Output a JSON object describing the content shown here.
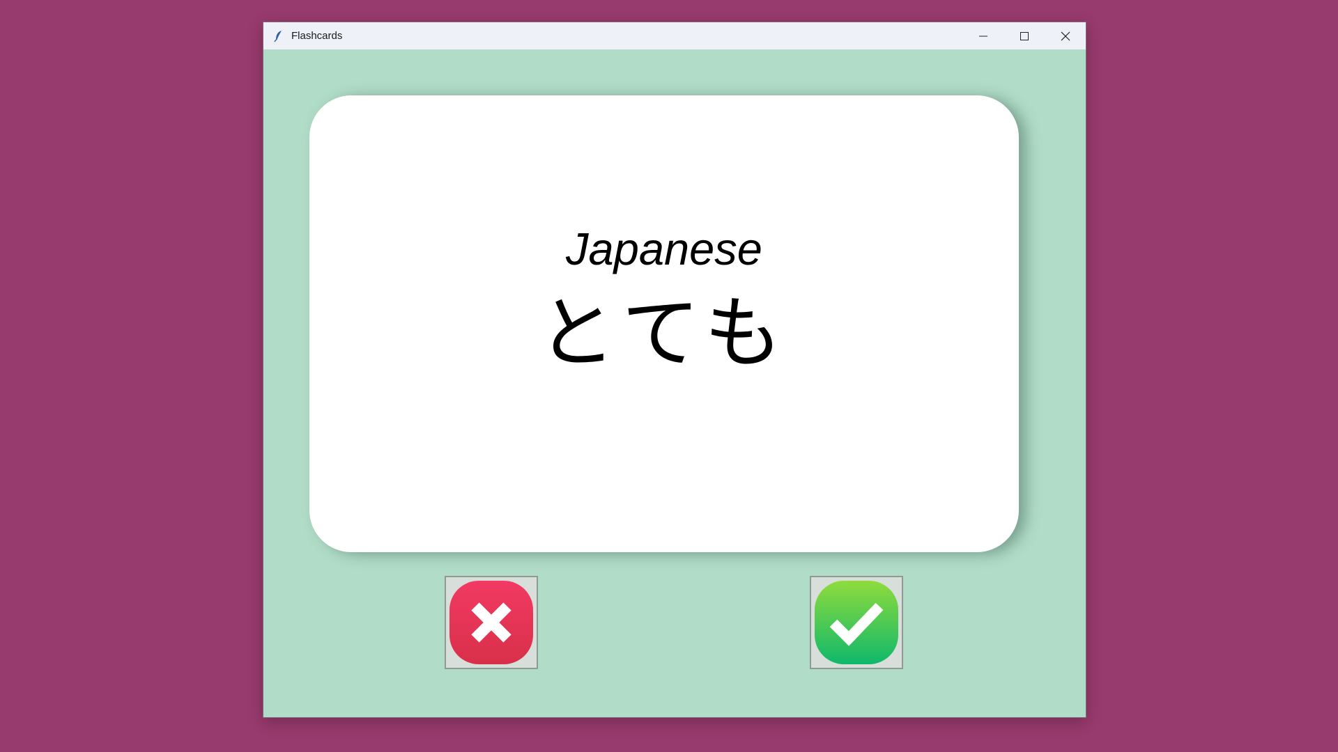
{
  "window": {
    "title": "Flashcards",
    "app_icon": "feather-icon",
    "controls": {
      "minimize_icon": "minimize-icon",
      "maximize_icon": "maximize-icon",
      "close_icon": "close-icon"
    }
  },
  "card": {
    "language": "Japanese",
    "word": "とても"
  },
  "buttons": {
    "wrong_icon": "x-icon",
    "right_icon": "check-icon"
  },
  "colors": {
    "desktop_background": "#973a6d",
    "window_background": "#b1dcc7",
    "card_background": "#ffffff",
    "wrong_button": "#e3364f",
    "right_button": "#2ec455"
  }
}
